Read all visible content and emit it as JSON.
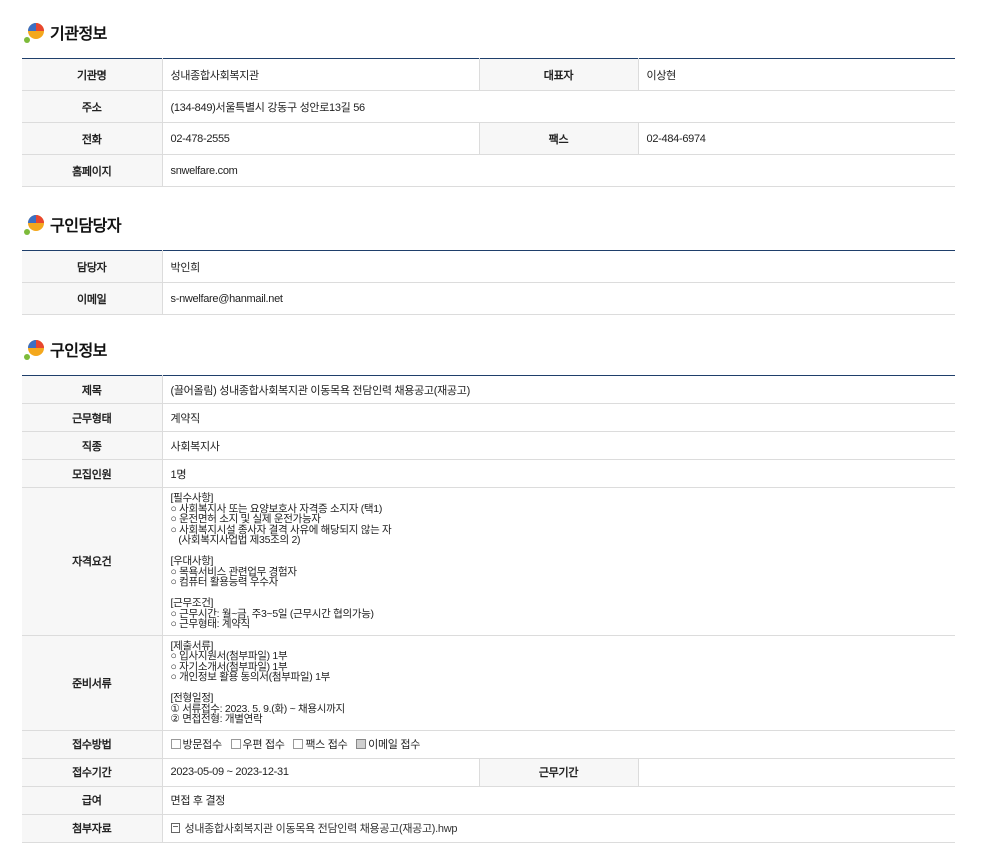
{
  "sections": {
    "org": "기관정보",
    "contact": "구인담당자",
    "job": "구인정보"
  },
  "org": {
    "name_label": "기관명",
    "name": "성내종합사회복지관",
    "rep_label": "대표자",
    "rep": "이상현",
    "address_label": "주소",
    "address": "(134-849)서울특별시 강동구 성안로13길 56",
    "phone_label": "전화",
    "phone": "02-478-2555",
    "fax_label": "팩스",
    "fax": "02-484-6974",
    "homepage_label": "홈페이지",
    "homepage": "snwelfare.com"
  },
  "contact": {
    "manager_label": "담당자",
    "manager": "박인희",
    "email_label": "이메일",
    "email": "s-nwelfare@hanmail.net"
  },
  "job": {
    "title_label": "제목",
    "title": "(끌어올림) 성내종합사회복지관 이동목욕 전담인력 채용공고(재공고)",
    "type_label": "근무형태",
    "type": "계약직",
    "category_label": "직종",
    "category": "사회복지사",
    "headcount_label": "모집인원",
    "headcount": "1명",
    "qualification_label": "자격요건",
    "qualification": "[필수사항]\n○ 사회복지사 또는 요양보호사 자격증 소지자 (택1)\n○ 운전면허 소지 및 실제 운전가능자\n○ 사회복지시설 종사자 결격 사유에 해당되지 않는 자\n   (사회복지사업법 제35조의 2)\n\n[우대사항]\n○ 목욕서비스 관련업무 경험자\n○ 컴퓨터 활용능력 우수자\n\n[근무조건]\n○ 근무시간: 월~금, 주3~5일 (근무시간 협의가능)\n○ 근무형태: 계약직",
    "documents_label": "준비서류",
    "documents": "[제출서류]\n○ 입사지원서(첨부파일) 1부\n○ 자기소개서(첨부파일) 1부\n○ 개인정보 활용 동의서(첨부파일) 1부\n\n[전형일정]\n① 서류접수: 2023. 5. 9.(화) ~ 채용시까지\n② 면접전형: 개별연락",
    "method_label": "접수방법",
    "methods": [
      {
        "label": "방문접수",
        "checked": false
      },
      {
        "label": "우편 접수",
        "checked": false
      },
      {
        "label": "팩스 접수",
        "checked": false
      },
      {
        "label": "이메일 접수",
        "checked": true
      }
    ],
    "period_label": "접수기간",
    "period": "2023-05-09 ~ 2023-12-31",
    "work_period_label": "근무기간",
    "work_period": "",
    "salary_label": "급여",
    "salary": "면접 후 결정",
    "attachment_label": "첨부자료",
    "attachment": "성내종합사회복지관 이동목욕 전담인력 채용공고(재공고).hwp"
  }
}
